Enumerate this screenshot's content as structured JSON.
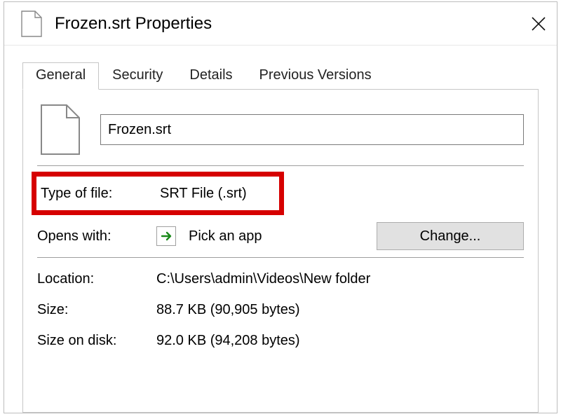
{
  "titlebar": {
    "title": "Frozen.srt Properties"
  },
  "tabs": {
    "general": "General",
    "security": "Security",
    "details": "Details",
    "previous": "Previous Versions"
  },
  "general": {
    "filename": "Frozen.srt",
    "type_label": "Type of file:",
    "type_value": "SRT File (.srt)",
    "opens_label": "Opens with:",
    "opens_value": "Pick an app",
    "change_label": "Change...",
    "location_label": "Location:",
    "location_value": "C:\\Users\\admin\\Videos\\New folder",
    "size_label": "Size:",
    "size_value": "88.7 KB (90,905 bytes)",
    "sizeondisk_label": "Size on disk:",
    "sizeondisk_value": "92.0 KB (94,208 bytes)"
  }
}
